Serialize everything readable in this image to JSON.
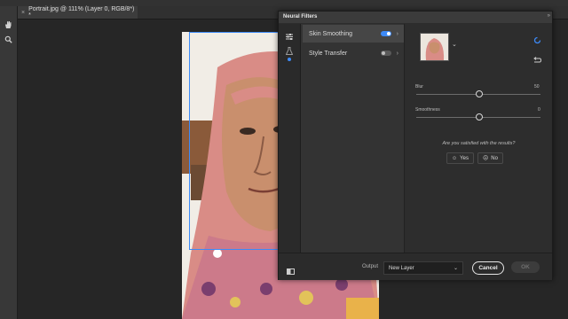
{
  "document": {
    "tab_title": "Portrait.jpg @ 111% (Layer 0, RGB/8*) *",
    "close_glyph": "×"
  },
  "neural_filters": {
    "title": "Neural Filters",
    "filters": [
      {
        "label": "Skin Smoothing",
        "enabled": true
      },
      {
        "label": "Style Transfer",
        "enabled": false
      }
    ],
    "sliders": [
      {
        "label": "Blur",
        "value": "50"
      },
      {
        "label": "Smoothness",
        "value": "0"
      }
    ],
    "feedback": {
      "question": "Are you satisfied with the results?",
      "yes": "Yes",
      "no": "No"
    },
    "output": {
      "label": "Output",
      "value": "New Layer"
    },
    "cancel": "Cancel",
    "ok": "OK"
  },
  "colors": {
    "accent": "#3d8af7",
    "panel_bg": "#2c2c2c"
  },
  "icons": [
    "hand-icon",
    "zoom-icon",
    "sliders-icon",
    "flask-icon",
    "refresh-icon",
    "reset-icon",
    "smile-icon",
    "frown-icon",
    "chevron-right-icon",
    "chevron-down-icon",
    "compare-icon",
    "expand-icon"
  ]
}
